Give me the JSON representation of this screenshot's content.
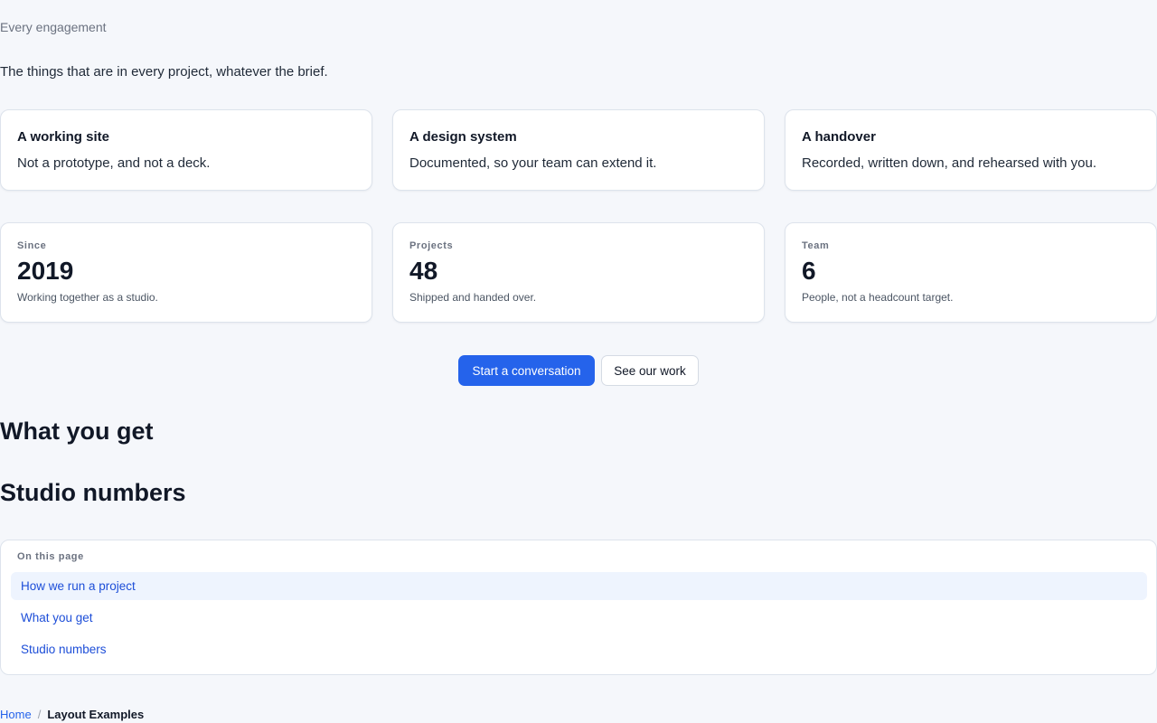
{
  "intro": {
    "eyebrow": "Every engagement",
    "lede": "The things that are in every project, whatever the brief."
  },
  "features": [
    {
      "title": "A working site",
      "description": "Not a prototype, and not a deck."
    },
    {
      "title": "A design system",
      "description": "Documented, so your team can extend it."
    },
    {
      "title": "A handover",
      "description": "Recorded, written down, and rehearsed with you."
    }
  ],
  "stats": [
    {
      "label": "Since",
      "value": "2019",
      "note": "Working together as a studio."
    },
    {
      "label": "Projects",
      "value": "48",
      "note": "Shipped and handed over."
    },
    {
      "label": "Team",
      "value": "6",
      "note": "People, not a headcount target."
    }
  ],
  "actions": {
    "primary_label": "Start a conversation",
    "secondary_label": "See our work"
  },
  "sections": {
    "what_you_get": "What you get",
    "studio_numbers": "Studio numbers"
  },
  "toc": {
    "heading": "On this page",
    "items": [
      "How we run a project",
      "What you get",
      "Studio numbers"
    ],
    "active_index": 0
  },
  "breadcrumb": {
    "home": "Home",
    "separator": "/",
    "current": "Layout Examples"
  },
  "colors": {
    "accent": "#2563eb",
    "background": "#f5f7fb",
    "active_item_bg": "#eef4fe"
  }
}
